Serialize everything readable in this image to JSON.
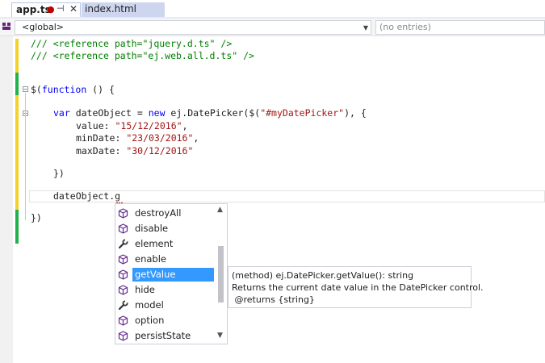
{
  "tabs": [
    {
      "label": "app.ts",
      "active": true,
      "dirty_marker": "●",
      "pin_glyph": "⊣",
      "close_glyph": "✕"
    },
    {
      "label": "index.html",
      "active": false
    }
  ],
  "navbar": {
    "scope_value": "<global>",
    "members_value": "(no entries)"
  },
  "code_lines": {
    "l1": "/// <reference path=\"jquery.d.ts\" />",
    "l2": "/// <reference path=\"ej.web.all.d.ts\" />",
    "l4a": "$(",
    "l4b": "function",
    "l4c": " () {",
    "l6a": "var",
    "l6b": " dateObject = ",
    "l6c": "new",
    "l6d": " ej.DatePicker($(",
    "l6e": "\"#myDatePicker\"",
    "l6f": "), {",
    "l7a": "value: ",
    "l7b": "\"15/12/2016\"",
    "l7c": ",",
    "l8a": "minDate: ",
    "l8b": "\"23/03/2016\"",
    "l8c": ",",
    "l9a": "maxDate: ",
    "l9b": "\"30/12/2016\"",
    "l11": "})",
    "l13": "dateObject.g",
    "l15": "})"
  },
  "completion": {
    "items": [
      {
        "label": "destroyAll",
        "icon": "method-cube-icon"
      },
      {
        "label": "disable",
        "icon": "method-cube-icon"
      },
      {
        "label": "element",
        "icon": "property-wrench-icon"
      },
      {
        "label": "enable",
        "icon": "method-cube-icon"
      },
      {
        "label": "getValue",
        "icon": "method-cube-icon",
        "selected": true
      },
      {
        "label": "hide",
        "icon": "method-cube-icon"
      },
      {
        "label": "model",
        "icon": "property-wrench-icon"
      },
      {
        "label": "option",
        "icon": "method-cube-icon"
      },
      {
        "label": "persistState",
        "icon": "method-cube-icon"
      }
    ]
  },
  "tooltip": {
    "signature": "(method) ej.DatePicker.getValue(): string",
    "description": "Returns the current date value in the DatePicker control.",
    "returns": " @returns {string}"
  },
  "colors": {
    "selection": "#3399ff",
    "change_saved": "#22b14c",
    "change_unsaved": "#f2d22b",
    "comment": "#008000",
    "keyword": "#0000ff",
    "string": "#a31515"
  }
}
